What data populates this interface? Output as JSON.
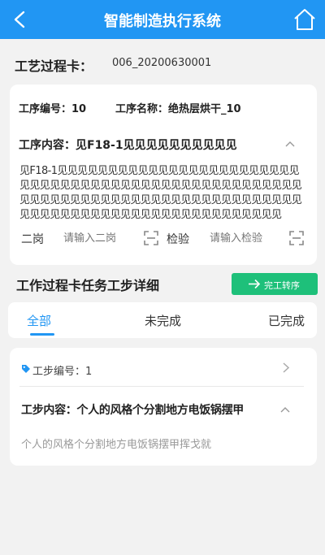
{
  "header": {
    "title": "智能制造执行系统"
  },
  "card": {
    "label": "工艺过程卡：",
    "value": "006_20200630001"
  },
  "process": {
    "no_text": "工序编号：10",
    "name_text": "工序名称：绝热层烘干_10",
    "content_label": "工序内容：见F18-1见见见见见见见见见见",
    "content_text": "见F18-1见见见见见见见见见见见见见见见见见见见见见见见见见见见见见见见见见见见见见见见见见见见见见见见见见见见见见见见见见见见见见见见见见见见见见见见见见见见见见见见见见见见见见见见见见见见见见见见见见见见见见见见见见见",
    "fields": [
      {
        "label": "二岗",
        "placeholder": "请输入二岗"
      },
      {
        "label": "检验",
        "placeholder": "请输入检验"
      }
    ]
  },
  "section": {
    "title": "工作过程卡任务工步详细",
    "button_label": "完工转序"
  },
  "tabs": [
    "全部",
    "未完成",
    "已完成"
  ],
  "step": {
    "no_text": "工步编号：1",
    "content_label": "工步内容：个人的风格个分割地方电饭锅摆甲",
    "content_text": "个人的风格个分割地方电饭锅摆甲挥戈就"
  },
  "colors": {
    "primary": "#2196f3",
    "success": "#1ec07a",
    "background": "#f2f2f2"
  }
}
